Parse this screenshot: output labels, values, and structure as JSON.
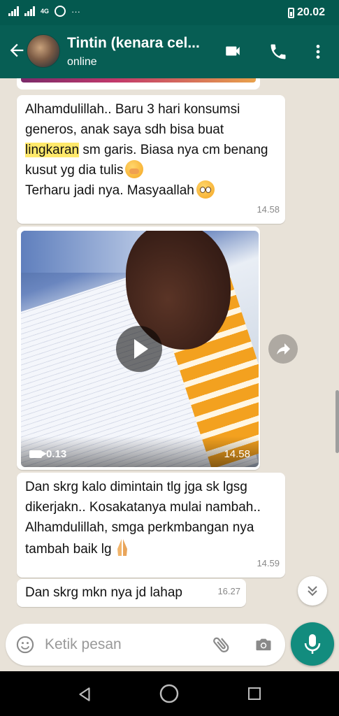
{
  "status_bar": {
    "network_label": "4G",
    "time": "20.02"
  },
  "header": {
    "contact_name": "Tintin (kenara cel...",
    "status": "online"
  },
  "messages": [
    {
      "text_before": "Alhamdulillah.. Baru 3 hari konsumsi generos, anak saya sdh bisa buat ",
      "highlight": "lingkaran",
      "text_after": " sm garis. Biasa nya cm benang kusut yg dia tulis",
      "line2": "Terharu jadi nya. Masyaallah",
      "time": "14.58"
    },
    {
      "type": "video",
      "duration": "0.13",
      "time": "14.58"
    },
    {
      "text": "Dan skrg kalo dimintain tlg jga sk lgsg dikerjakn.. Kosakatanya mulai nambah.. Alhamdulillah, smga perkmbangan nya tambah baik lg",
      "time": "14.59"
    },
    {
      "text": "Dan skrg mkn nya jd lahap",
      "time": "16.27"
    }
  ],
  "composer": {
    "placeholder": "Ketik pesan"
  },
  "icons": {
    "header": [
      "back-arrow-icon",
      "video-call-icon",
      "phone-icon",
      "more-vert-icon"
    ],
    "composer": [
      "emoji-icon",
      "attach-icon",
      "camera-icon",
      "mic-icon"
    ],
    "nav": [
      "nav-back-icon",
      "nav-home-icon",
      "nav-recents-icon"
    ]
  },
  "colors": {
    "header": "#075e54",
    "status_bar": "#04594f",
    "accent": "#128c7e",
    "highlight": "#ffe96b"
  }
}
